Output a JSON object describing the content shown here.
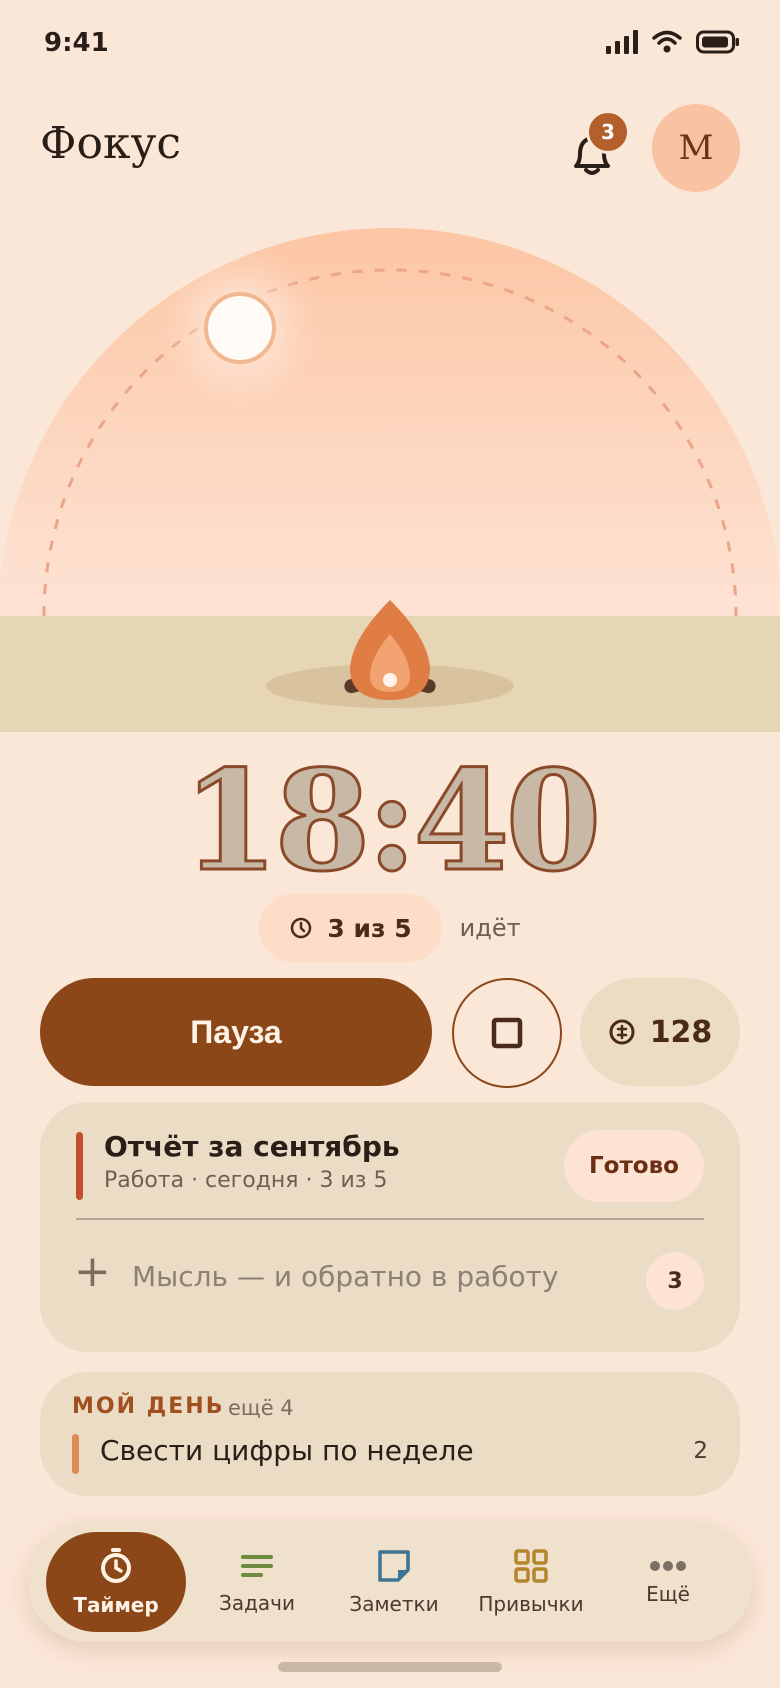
{
  "status_bar": {
    "time": "9:41"
  },
  "header": {
    "title": "Фокус",
    "notifications_count": "3",
    "avatar_initial": "М"
  },
  "timer": {
    "time": "18:40",
    "session": "3 из 5",
    "status": "идёт"
  },
  "controls": {
    "pause_label": "Пауза",
    "coins": "128"
  },
  "current_task": {
    "title": "Отчёт за сентябрь",
    "meta": "Работа · сегодня · 3 из 5",
    "done_label": "Готово",
    "thought_placeholder": "Мысль — и обратно в работу",
    "thought_count": "3"
  },
  "my_day": {
    "label": "МОЙ ДЕНЬ",
    "more": "ещё 4",
    "item": "Свести цифры по неделе",
    "item_count": "2"
  },
  "tabs": [
    {
      "label": "Таймер",
      "icon": "stopwatch-icon",
      "active": true
    },
    {
      "label": "Задачи",
      "icon": "list-icon"
    },
    {
      "label": "Заметки",
      "icon": "note-icon"
    },
    {
      "label": "Привычки",
      "icon": "grid-icon"
    },
    {
      "label": "Ещё",
      "icon": "more-icon"
    }
  ],
  "colors": {
    "background": "#FBE7D8",
    "accent": "#8B4718",
    "flame": "#E08A55",
    "task_accent": "#C24E2C"
  }
}
